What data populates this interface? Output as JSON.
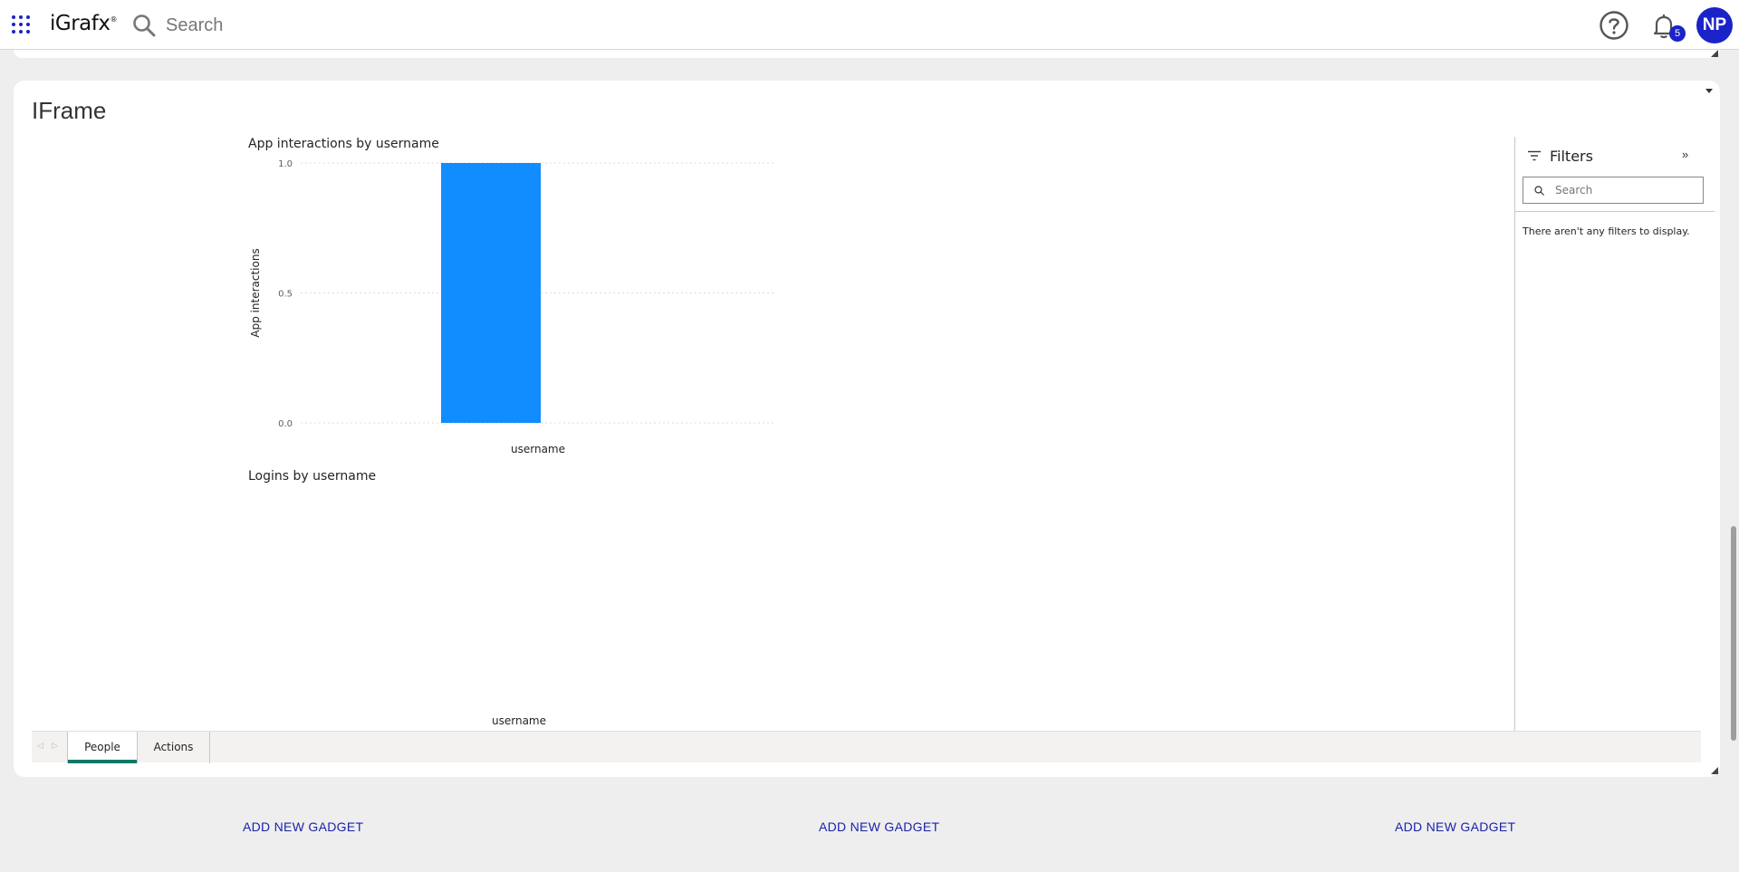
{
  "topbar": {
    "logo_text": "iGrafx",
    "logo_mark": "®",
    "search_placeholder": "Search",
    "notification_count": "5",
    "avatar_initials": "NP",
    "accent_color": "#1a23c8"
  },
  "card": {
    "title": "IFrame"
  },
  "report": {
    "chart1": {
      "title": "App interactions by username",
      "ylabel": "App interactions",
      "xlabel": "username"
    },
    "chart2": {
      "title": "Logins by username",
      "xlabel": "username"
    },
    "filters": {
      "title": "Filters",
      "search_placeholder": "Search",
      "empty_message": "There aren't any filters to display."
    },
    "tabs": [
      {
        "label": "People",
        "active": true
      },
      {
        "label": "Actions",
        "active": false
      }
    ]
  },
  "chart_data": [
    {
      "type": "bar",
      "title": "App interactions by username",
      "xlabel": "username",
      "ylabel": "App interactions",
      "categories": [
        ""
      ],
      "values": [
        1.0
      ],
      "ylim": [
        0,
        1.0
      ],
      "yticks": [
        "0.0",
        "0.5",
        "1.0"
      ],
      "grid": true,
      "bar_color": "#118dff"
    },
    {
      "type": "bar",
      "title": "Logins by username",
      "xlabel": "username",
      "categories": [],
      "values": []
    }
  ],
  "footer": {
    "add_gadget_labels": [
      "ADD NEW GADGET",
      "ADD NEW GADGET",
      "ADD NEW GADGET"
    ]
  }
}
